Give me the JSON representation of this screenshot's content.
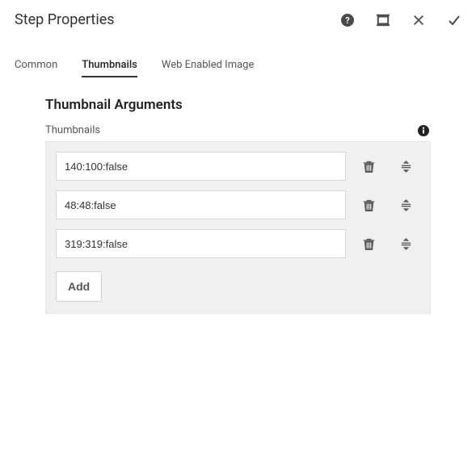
{
  "header": {
    "title": "Step Properties"
  },
  "tabs": {
    "common": "Common",
    "thumbnails": "Thumbnails",
    "webEnabled": "Web Enabled Image"
  },
  "section": {
    "title": "Thumbnail Arguments",
    "fieldLabel": "Thumbnails"
  },
  "rows": [
    {
      "value": "140:100:false"
    },
    {
      "value": "48:48:false"
    },
    {
      "value": "319:319:false"
    }
  ],
  "buttons": {
    "add": "Add"
  }
}
